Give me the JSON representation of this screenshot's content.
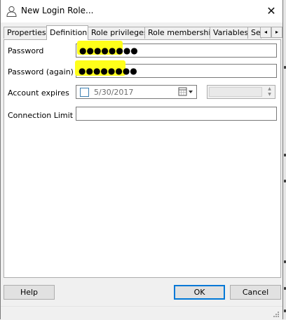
{
  "window": {
    "title": "New Login Role...",
    "close_glyph": "✕"
  },
  "tabs": [
    {
      "label": "Properties",
      "active": false
    },
    {
      "label": "Definition",
      "active": true
    },
    {
      "label": "Role privileges",
      "active": false
    },
    {
      "label": "Role membership",
      "active": false
    },
    {
      "label": "Variables",
      "active": false
    },
    {
      "label": "Se",
      "active": false
    }
  ],
  "tab_scroll": {
    "left": "◂",
    "right": "▸"
  },
  "form": {
    "password_label": "Password",
    "password_value": "●●●●●●●●",
    "password_again_label": "Password (again)",
    "password_again_value": "●●●●●●●●",
    "account_expires_label": "Account expires",
    "account_expires_date": "5/30/2017",
    "account_expires_checked": false,
    "connection_limit_label": "Connection Limit",
    "connection_limit_value": ""
  },
  "buttons": {
    "help": "Help",
    "ok": "OK",
    "cancel": "Cancel"
  },
  "colors": {
    "highlight": "#ffff1a",
    "accent": "#0078d7"
  },
  "icons": [
    "user-icon",
    "close-icon",
    "calendar-icon",
    "chevron-down-icon",
    "spin-up-icon",
    "spin-down-icon",
    "tab-scroll-left-icon",
    "tab-scroll-right-icon"
  ]
}
